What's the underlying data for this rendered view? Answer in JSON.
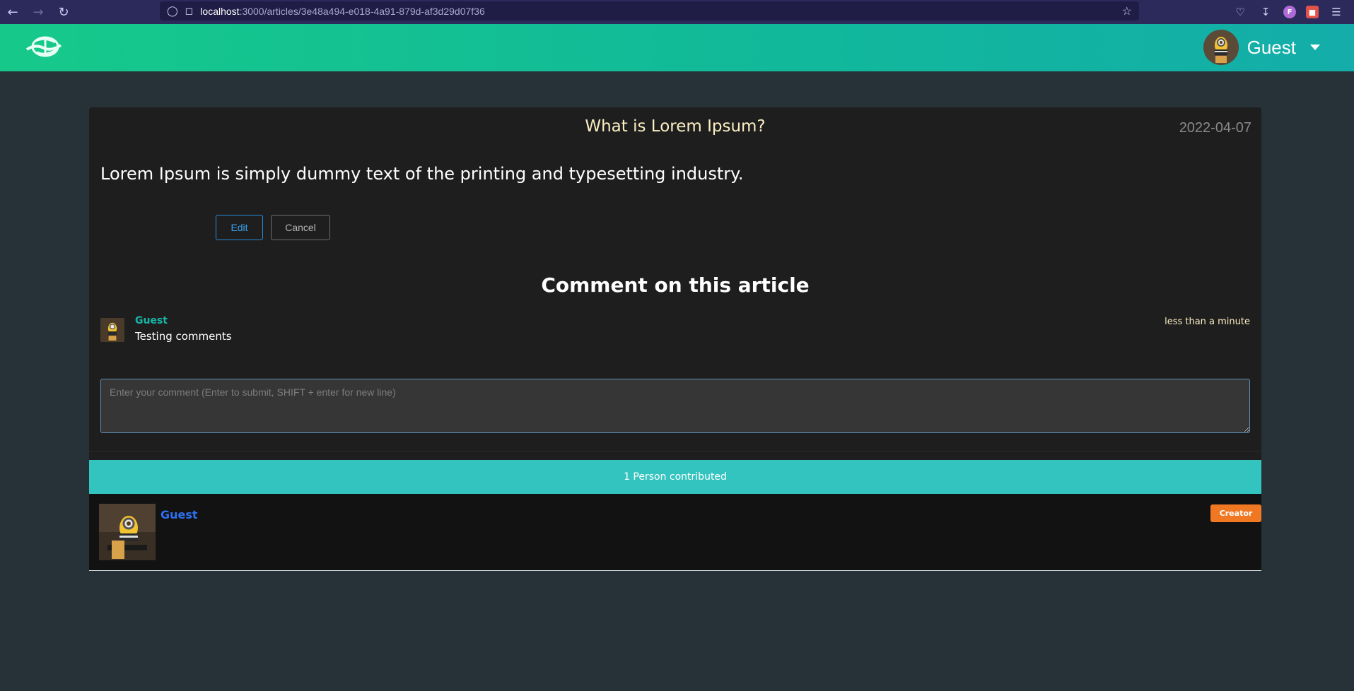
{
  "browser": {
    "url_host": "localhost",
    "url_path": ":3000/articles/3e48a494-e018-4a91-879d-af3d29d07f36",
    "profile_initial": "F"
  },
  "header": {
    "username": "Guest"
  },
  "article": {
    "title": "What is Lorem Ipsum?",
    "date": "2022-04-07",
    "body": "Lorem Ipsum is simply dummy text of the printing and typesetting industry.",
    "edit_label": "Edit",
    "cancel_label": "Cancel"
  },
  "comments": {
    "heading": "Comment on this article",
    "items": [
      {
        "author": "Guest",
        "text": "Testing comments",
        "time": "less than a minute"
      }
    ],
    "input_placeholder": "Enter your comment (Enter to submit, SHIFT + enter for new line)"
  },
  "contributors": {
    "summary": "1 Person contributed",
    "items": [
      {
        "name": "Guest",
        "role": "Creator"
      }
    ]
  },
  "colors": {
    "header_start": "#16c98a",
    "header_end": "#14adaa",
    "contrib_bar": "#34c4c0",
    "creator_badge": "#f07822",
    "comment_author": "#17b6a6",
    "contributor_name": "#2e6ff0"
  }
}
